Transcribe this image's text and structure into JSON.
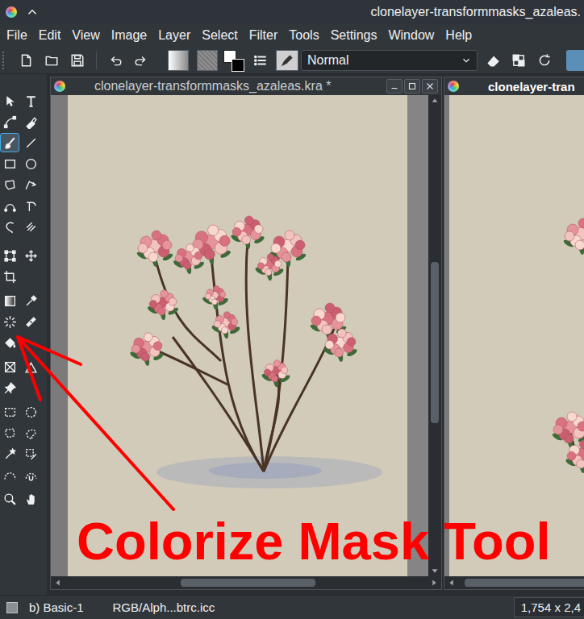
{
  "window": {
    "title": "clonelayer-transformmasks_azaleas."
  },
  "menu": [
    "File",
    "Edit",
    "View",
    "Image",
    "Layer",
    "Select",
    "Filter",
    "Tools",
    "Settings",
    "Window",
    "Help"
  ],
  "toolbar": {
    "blend_mode": "Normal"
  },
  "toolbox": {
    "tools": [
      {
        "selected": false
      },
      {
        "selected": false
      },
      {
        "selected": false
      },
      {
        "selected": false
      },
      {
        "selected": true
      },
      {
        "selected": false
      },
      {
        "selected": false
      },
      {
        "selected": false
      },
      {
        "selected": false
      },
      {
        "selected": false
      },
      {
        "selected": false
      },
      {
        "selected": false
      },
      {
        "selected": false
      },
      {
        "selected": false
      },
      {
        "selected": false
      },
      {
        "selected": false
      },
      {
        "selected": false
      },
      {
        "selected": false
      },
      {
        "selected": false
      },
      {
        "selected": false
      },
      {
        "selected": false
      },
      {
        "selected": false
      },
      {
        "selected": false
      },
      {
        "selected": false
      },
      {
        "selected": false
      },
      {
        "selected": false
      },
      {
        "selected": false
      },
      {
        "selected": false
      },
      {
        "selected": false
      },
      {
        "selected": false
      },
      {
        "selected": false
      },
      {
        "selected": false
      },
      {
        "selected": false
      },
      {
        "selected": false
      },
      {
        "selected": false
      }
    ]
  },
  "documents": [
    {
      "title": "clonelayer-transformmasks_azaleas.kra *",
      "active": false,
      "scroll": {
        "vertical": {
          "start": 0.34,
          "size": 0.35
        },
        "horizontal": {
          "start": 0.32,
          "size": 0.37
        }
      }
    },
    {
      "title": "clonelayer-tran",
      "active": true,
      "scroll": {
        "horizontal": {
          "start": 0.02,
          "size": 0.9
        }
      }
    }
  ],
  "annotation": {
    "text": "Colorize Mask Tool"
  },
  "status_bar": {
    "brush": "b) Basic-1",
    "color_space": "RGB/Alph...btrc.icc",
    "canvas_size": "1,754 x 2,4"
  }
}
